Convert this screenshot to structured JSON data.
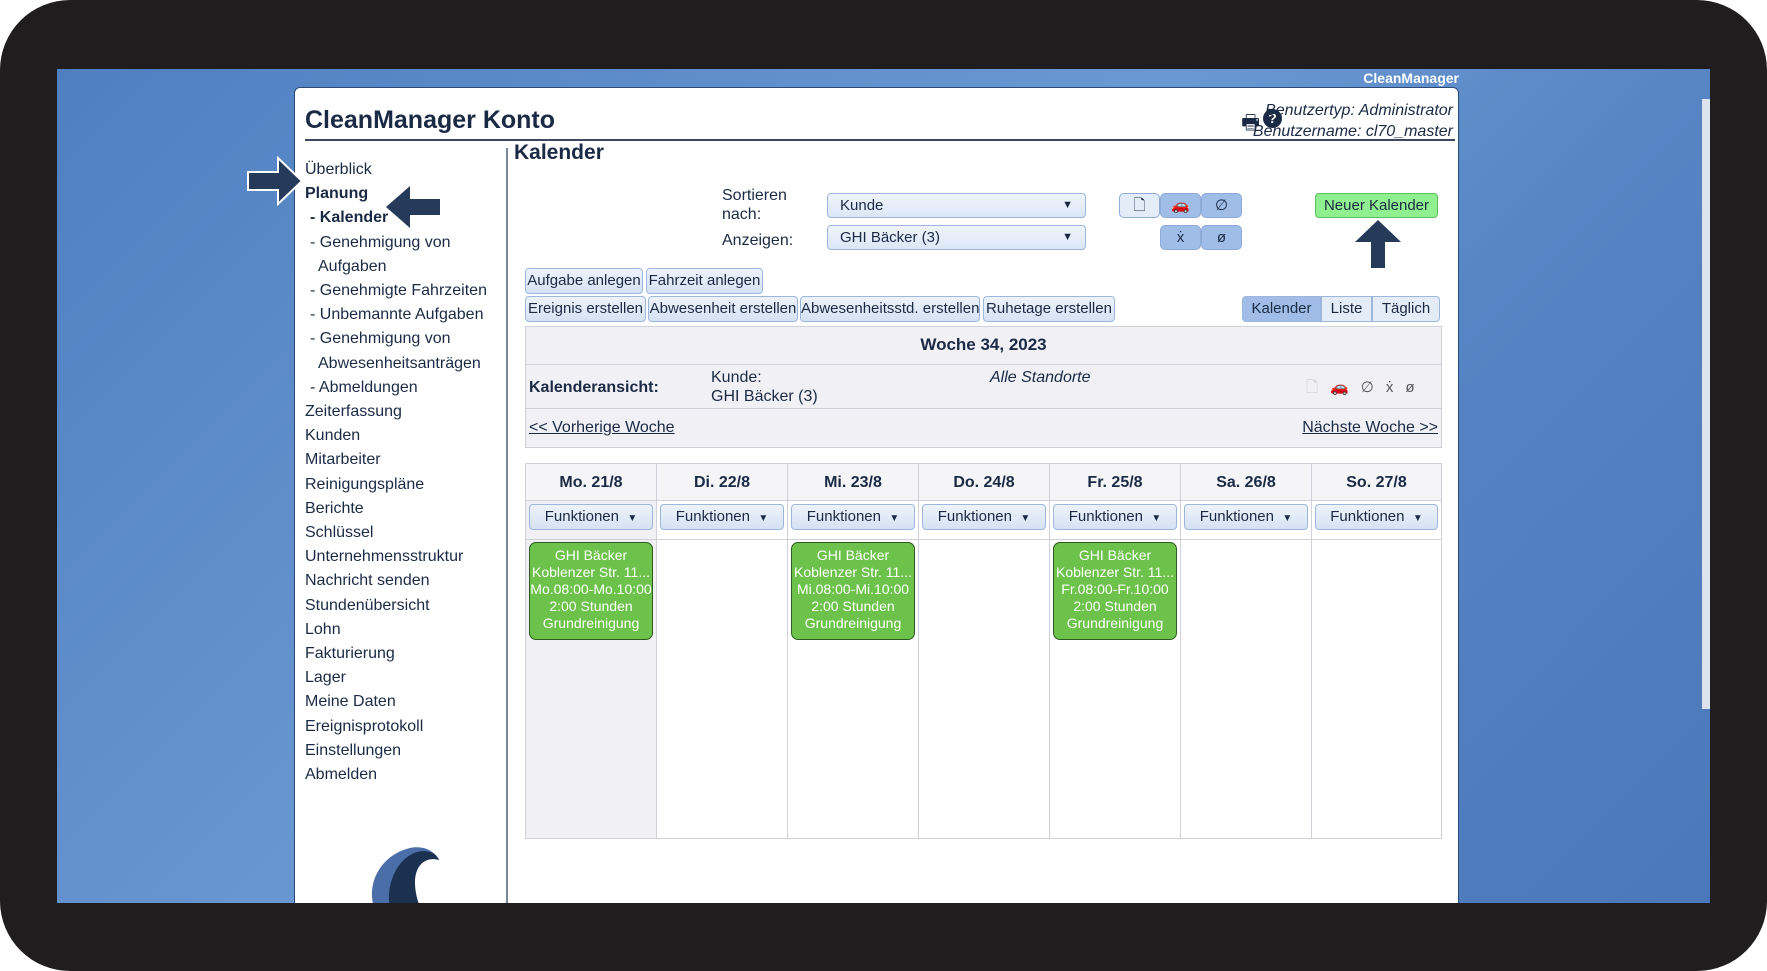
{
  "brand": "CleanManager",
  "header": {
    "title": "CleanManager Konto",
    "user_type": "Benutzertyp: Administrator",
    "user_name": "Benutzername: cl70_master"
  },
  "sidebar": {
    "items": [
      {
        "label": "Überblick"
      },
      {
        "label": "Planung",
        "bold": true
      },
      {
        "label": "- Kalender",
        "bold": true,
        "sub": true
      },
      {
        "label": "- Genehmigung von",
        "sub": true
      },
      {
        "label": "Aufgaben",
        "cont": true
      },
      {
        "label": "- Genehmigte Fahrzeiten",
        "sub": true
      },
      {
        "label": "- Unbemannte Aufgaben",
        "sub": true
      },
      {
        "label": "- Genehmigung von",
        "sub": true
      },
      {
        "label": "Abwesenheitsanträgen",
        "cont": true
      },
      {
        "label": "- Abmeldungen",
        "sub": true
      },
      {
        "label": "Zeiterfassung"
      },
      {
        "label": "Kunden"
      },
      {
        "label": "Mitarbeiter"
      },
      {
        "label": "Reinigungspläne"
      },
      {
        "label": "Berichte"
      },
      {
        "label": "Schlüssel"
      },
      {
        "label": "Unternehmensstruktur"
      },
      {
        "label": "Nachricht senden"
      },
      {
        "label": "Stundenübersicht"
      },
      {
        "label": "Lohn"
      },
      {
        "label": "Fakturierung"
      },
      {
        "label": "Lager"
      },
      {
        "label": "Meine Daten"
      },
      {
        "label": "Ereignisprotokoll"
      },
      {
        "label": "Einstellungen"
      },
      {
        "label": "Abmelden"
      }
    ]
  },
  "main": {
    "title": "Kalender",
    "sort_label": "Sortieren nach:",
    "sort_value": "Kunde",
    "show_label": "Anzeigen:",
    "show_value": "GHI Bäcker (3)",
    "new_calendar": "Neuer Kalender",
    "buttons_row1": [
      "Aufgabe anlegen",
      "Fahrzeit anlegen"
    ],
    "buttons_row2": [
      "Ereignis erstellen",
      "Abwesenheit erstellen",
      "Abwesenheitsstd. erstellen",
      "Ruhetage erstellen"
    ],
    "views": [
      {
        "label": "Kalender",
        "active": true
      },
      {
        "label": "Liste"
      },
      {
        "label": "Täglich"
      }
    ],
    "week": "Woche 34, 2023",
    "view_label": "Kalenderansicht:",
    "customer_label": "Kunde:",
    "customer_value": "GHI Bäcker (3)",
    "location": "Alle Standorte",
    "prev": "<< Vorherige Woche",
    "next": "Nächste Woche >>",
    "functions_label": "Funktionen",
    "days": [
      {
        "label": "Mo. 21/8",
        "event": [
          "GHI Bäcker",
          "Koblenzer Str. 11...",
          "Mo.08:00-Mo.10:00",
          "2:00 Stunden",
          "Grundreinigung"
        ]
      },
      {
        "label": "Di. 22/8"
      },
      {
        "label": "Mi. 23/8",
        "event": [
          "GHI Bäcker",
          "Koblenzer Str. 11...",
          "Mi.08:00-Mi.10:00",
          "2:00 Stunden",
          "Grundreinigung"
        ]
      },
      {
        "label": "Do. 24/8"
      },
      {
        "label": "Fr. 25/8",
        "event": [
          "GHI Bäcker",
          "Koblenzer Str. 11...",
          "Fr.08:00-Fr.10:00",
          "2:00 Stunden",
          "Grundreinigung"
        ]
      },
      {
        "label": "Sa. 26/8"
      },
      {
        "label": "So. 27/8"
      }
    ]
  },
  "colors": {
    "event": "#6cc24a",
    "new_button": "#90f090",
    "accent": "#9fbde6",
    "annotation_arrow": "#263a5a"
  }
}
